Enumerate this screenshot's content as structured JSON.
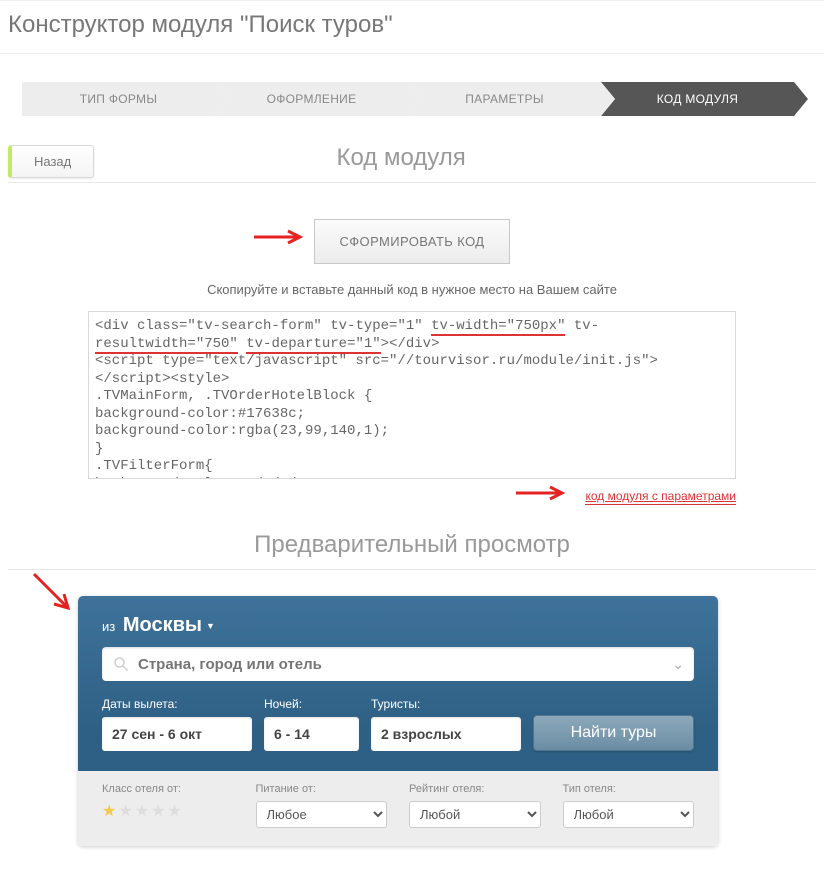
{
  "page_title": "Конструктор модуля \"Поиск туров\"",
  "crumbs": [
    "ТИП ФОРМЫ",
    "ОФОРМЛЕНИЕ",
    "ПАРАМЕТРЫ",
    "КОД МОДУЛЯ"
  ],
  "back": "Назад",
  "section_code_title": "Код модуля",
  "generate_btn": "СФОРМИРОВАТЬ КОД",
  "copy_instruction": "Скопируйте и вставьте данный код в нужное место на Вашем сайте",
  "code": {
    "l1a": "<div class=\"tv-search-form\" tv-type=\"1\" ",
    "l1u1": "tv-width=\"750px\"",
    "l1b": " tv-",
    "l2u1": "resultwidth=\"750\"",
    "l2mid": " ",
    "l2u2": "tv-departure=\"1\"",
    "l2b": "></div>",
    "l3": "<script type=\"text/javascript\" src=\"//tourvisor.ru/module/init.js\">",
    "l4": "</script><style>",
    "l5": ".TVMainForm, .TVOrderHotelBlock {",
    "l6": "background-color:#17638c;",
    "l7": "background-color:rgba(23,99,140,1);",
    "l8": "}",
    "l9": ".TVFilterForm{",
    "l10": "background-color:#ededed;"
  },
  "params_link": "код модуля с параметрами",
  "preview_title": "Предварительный просмотр",
  "widget": {
    "from_prefix": "из",
    "from_city": "Москвы",
    "search_placeholder": "Страна, город или отель",
    "dates_label": "Даты вылета:",
    "dates_value": "27 сен - 6 окт",
    "nights_label": "Ночей:",
    "nights_value": "6 - 14",
    "tourists_label": "Туристы:",
    "tourists_value": "2 взрослых",
    "find_btn": "Найти туры",
    "filters": {
      "class_label": "Класс отеля от:",
      "meal_label": "Питание от:",
      "meal_value": "Любое",
      "rating_label": "Рейтинг отеля:",
      "rating_value": "Любой",
      "type_label": "Тип отеля:",
      "type_value": "Любой"
    }
  }
}
